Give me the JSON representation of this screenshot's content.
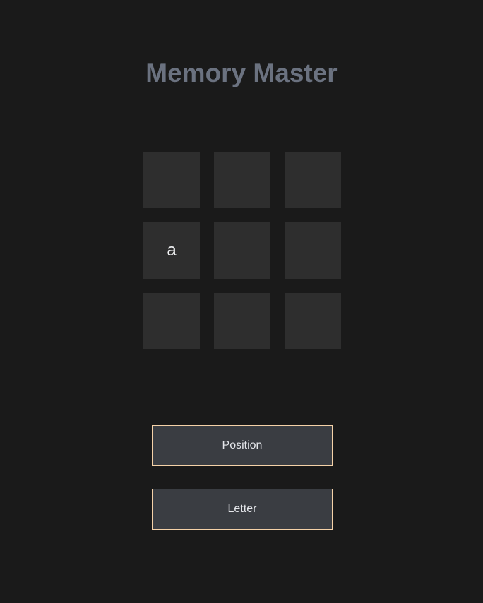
{
  "title": "Memory Master",
  "grid": {
    "rows": 3,
    "cols": 3,
    "cells": [
      "",
      "",
      "",
      "a",
      "",
      "",
      "",
      "",
      ""
    ]
  },
  "buttons": {
    "position_label": "Position",
    "letter_label": "Letter"
  },
  "colors": {
    "background": "#1a1a1a",
    "cell": "#2e2e2e",
    "title": "#6b7280",
    "button_bg": "#3a3d42",
    "button_border": "#f5d2a8"
  }
}
